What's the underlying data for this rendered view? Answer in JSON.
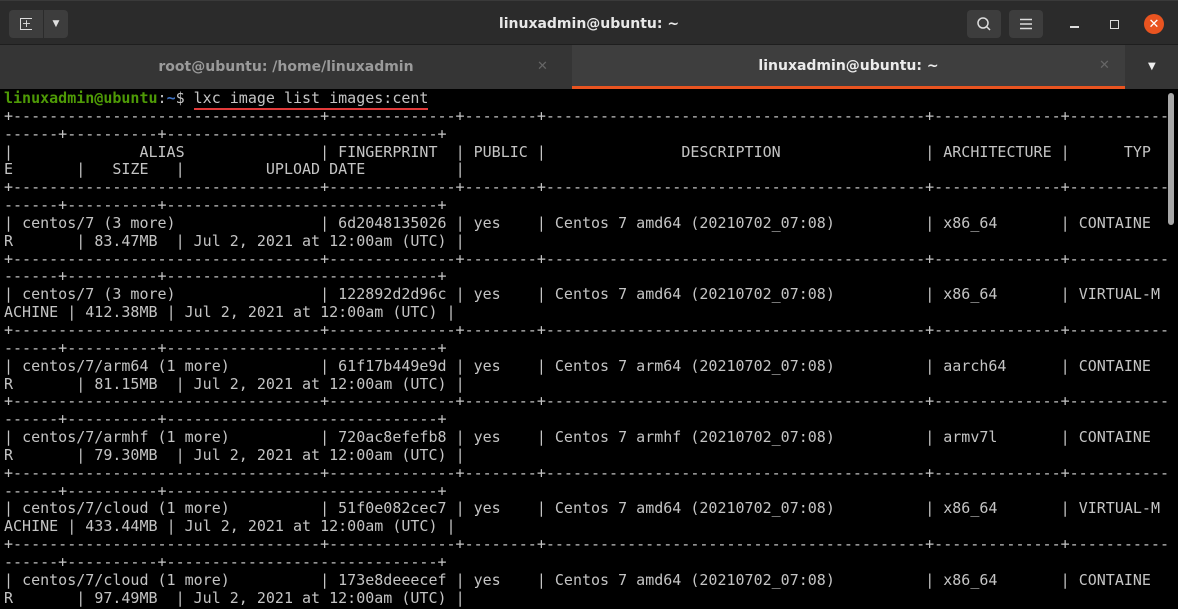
{
  "window": {
    "title": "linuxadmin@ubuntu: ~"
  },
  "tabs": [
    {
      "label": "root@ubuntu: /home/linuxadmin",
      "active": false
    },
    {
      "label": "linuxadmin@ubuntu: ~",
      "active": true
    }
  ],
  "prompt": {
    "user_host": "linuxadmin@ubuntu",
    "sep": ":",
    "path": "~",
    "symbol": "$ ",
    "command": "lxc image list images:cent"
  },
  "table": {
    "headers": [
      "ALIAS",
      "FINGERPRINT",
      "PUBLIC",
      "DESCRIPTION",
      "ARCHITECTURE",
      "TYPE",
      "SIZE",
      "UPLOAD DATE"
    ],
    "rows": [
      [
        "centos/7 (3 more)",
        "6d2048135026",
        "yes",
        "Centos 7 amd64 (20210702_07:08)",
        "x86_64",
        "CONTAINER",
        "83.47MB",
        "Jul 2, 2021 at 12:00am (UTC)"
      ],
      [
        "centos/7 (3 more)",
        "122892d2d96c",
        "yes",
        "Centos 7 amd64 (20210702_07:08)",
        "x86_64",
        "VIRTUAL-MACHINE",
        "412.38MB",
        "Jul 2, 2021 at 12:00am (UTC)"
      ],
      [
        "centos/7/arm64 (1 more)",
        "61f17b449e9d",
        "yes",
        "Centos 7 arm64 (20210702_07:08)",
        "aarch64",
        "CONTAINER",
        "81.15MB",
        "Jul 2, 2021 at 12:00am (UTC)"
      ],
      [
        "centos/7/armhf (1 more)",
        "720ac8efefb8",
        "yes",
        "Centos 7 armhf (20210702_07:08)",
        "armv7l",
        "CONTAINER",
        "79.30MB",
        "Jul 2, 2021 at 12:00am (UTC)"
      ],
      [
        "centos/7/cloud (1 more)",
        "51f0e082cec7",
        "yes",
        "Centos 7 amd64 (20210702_07:08)",
        "x86_64",
        "VIRTUAL-MACHINE",
        "433.44MB",
        "Jul 2, 2021 at 12:00am (UTC)"
      ],
      [
        "centos/7/cloud (1 more)",
        "173e8deeecef",
        "yes",
        "Centos 7 amd64 (20210702_07:08)",
        "x86_64",
        "CONTAINER",
        "97.49MB",
        "Jul 2, 2021 at 12:00am (UTC)"
      ]
    ]
  },
  "colors": {
    "accent": "#e95420",
    "prompt_user": "#4e9a06",
    "prompt_path": "#3f72c2"
  }
}
